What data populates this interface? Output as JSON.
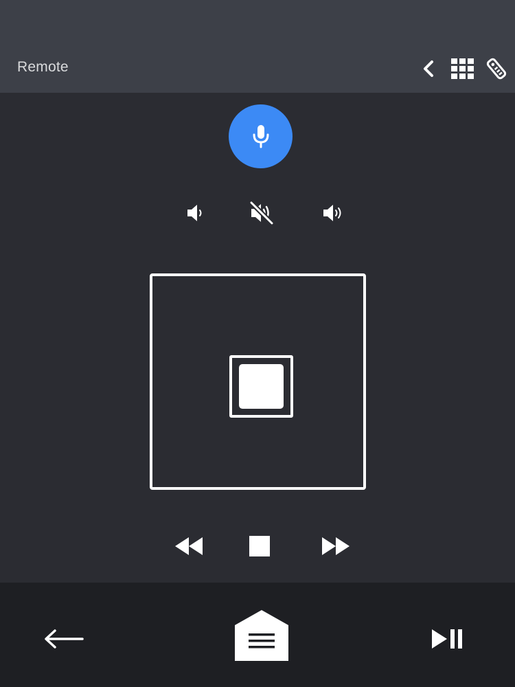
{
  "header": {
    "title": "Remote"
  },
  "icons": {
    "back": "chevron-left-icon",
    "grid": "grid-icon",
    "remote": "remote-control-icon",
    "mic": "microphone-icon",
    "volume_down": "volume-down-icon",
    "mute": "volume-mute-icon",
    "volume_up": "volume-up-icon",
    "rewind": "rewind-icon",
    "stop": "stop-icon",
    "fast_forward": "fast-forward-icon",
    "nav_back": "arrow-left-icon",
    "home": "home-icon",
    "play_pause": "play-pause-icon"
  },
  "colors": {
    "accent": "#3c8af5",
    "header_bg": "#3d4048",
    "main_bg": "#2b2c32",
    "bottom_bg": "#1e1f23",
    "icon": "#ffffff"
  }
}
